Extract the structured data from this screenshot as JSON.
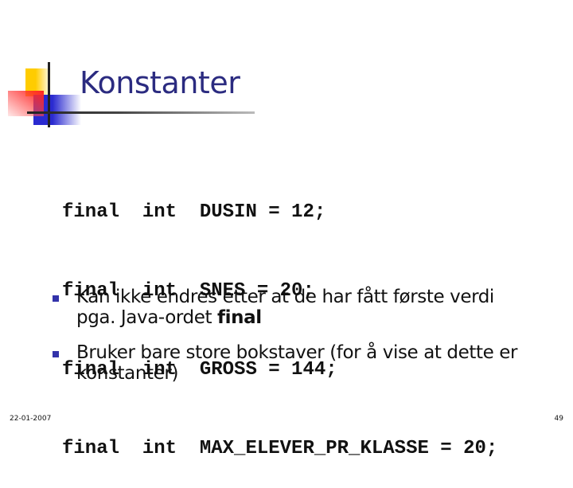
{
  "slide": {
    "title": "Konstanter",
    "code_lines": [
      "final  int  DUSIN = 12;",
      "final  int  SNES = 20;",
      "final  int  GROSS = 144;",
      "final  int  MAX_ELEVER_PR_KLASSE = 20;"
    ],
    "bullets": [
      {
        "text": "Kan ikke endres etter at de har fått første verdi pga. Java-ordet ",
        "bold": "final"
      },
      {
        "text": "Bruker bare store bokstaver (for å vise at dette er konstanter)",
        "bold": ""
      }
    ],
    "footer": {
      "date": "22-01-2007",
      "page_number": "49"
    },
    "colors": {
      "title": "#2b2b80",
      "bullet_marker": "#3333aa"
    },
    "icons": {
      "bullet": "square-bullet-icon",
      "logo": "decorative-squares-logo"
    }
  }
}
